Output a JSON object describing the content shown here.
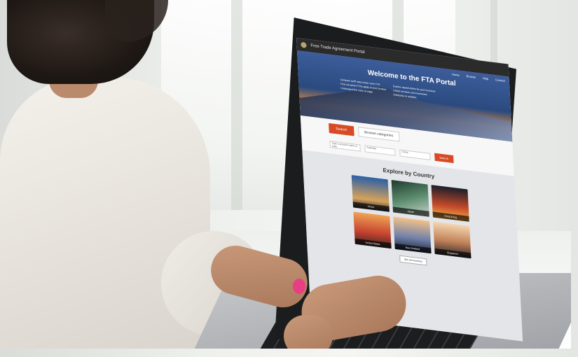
{
  "portal": {
    "site_title": "Free Trade Agreement Portal",
    "nav": [
      "Home",
      "Browse",
      "Help",
      "Contact"
    ],
    "hero_title": "Welcome to the FTA Portal",
    "hero_bullets": [
      "Compare tariff rates under each FTA",
      "Find out which FTAs apply to your product",
      "Understand the rules of origin",
      "Explore opportunities for your business",
      "Check services and investment",
      "Subscribe to updates"
    ],
    "search_label": "Search",
    "browse_label": "Browse categories",
    "product_hint": "Type a product name or code",
    "exporting_from_label": "I am exporting from",
    "exporting_to_label": "I am exporting to",
    "from_value": "Australia",
    "to_value": "China",
    "go_label": "Search",
    "explore_title": "Explore by Country",
    "countries": [
      "China",
      "Japan",
      "Hong Kong",
      "United States",
      "New Zealand",
      "Singapore"
    ],
    "see_all_label": "See all countries"
  },
  "colors": {
    "accent": "#d84a25",
    "header": "#2b2b2b",
    "nail_polish": "#e83e82"
  }
}
